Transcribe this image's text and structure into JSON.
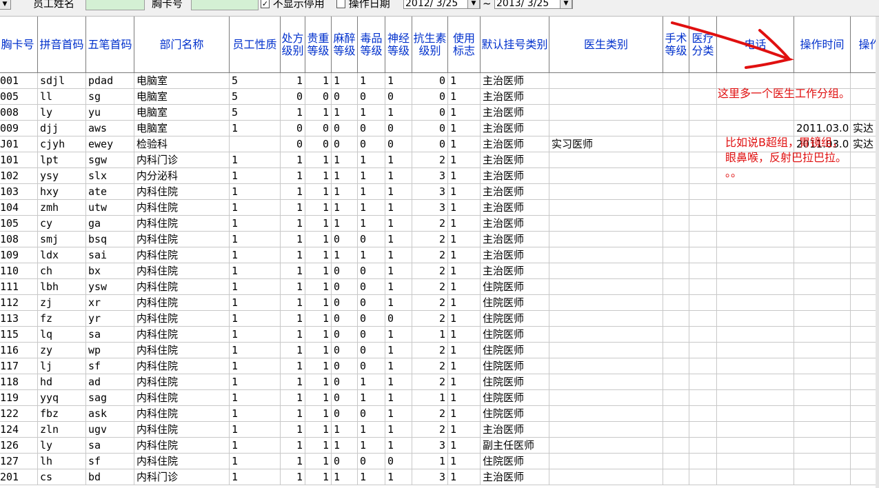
{
  "toolbar": {
    "f0_label": "",
    "name_label": "员工姓名",
    "name_value": "",
    "card_label": "胸卡号",
    "card_value": "",
    "hide_disabled_label": "不显示停用",
    "hide_disabled_checked": "✓",
    "op_date_label": "操作日期",
    "date_from": "2012/ 3/25",
    "date_sep": "~",
    "date_to": "2013/ 3/25"
  },
  "columns": [
    "胸卡号",
    "拼音首码",
    "五笔首码",
    "部门名称",
    "员工性质",
    "处方级别",
    "贵重等级",
    "麻醉等级",
    "毒品等级",
    "神经等级",
    "抗生素级别",
    "使用标志",
    "默认挂号类别",
    "医生类别",
    "手术等级",
    "医疗分类",
    "电话",
    "操作时间",
    "操作"
  ],
  "rows": [
    [
      "001",
      "sdjl",
      "pdad",
      "电脑室",
      "5",
      "1",
      "1",
      "1",
      "1",
      "1",
      "0",
      "1",
      "主治医师",
      "",
      "",
      "",
      "",
      "",
      ""
    ],
    [
      "005",
      "ll",
      "sg",
      "电脑室",
      "5",
      "0",
      "0",
      "0",
      "0",
      "0",
      "0",
      "1",
      "主治医师",
      "",
      "",
      "",
      "",
      "",
      ""
    ],
    [
      "008",
      "ly",
      "yu",
      "电脑室",
      "5",
      "1",
      "1",
      "1",
      "1",
      "1",
      "0",
      "1",
      "主治医师",
      "",
      "",
      "",
      "",
      "",
      ""
    ],
    [
      "009",
      "djj",
      "aws",
      "电脑室",
      "1",
      "0",
      "0",
      "0",
      "0",
      "0",
      "0",
      "1",
      "主治医师",
      "",
      "",
      "",
      "",
      "2011.03.0",
      "实达"
    ],
    [
      "J01",
      "cjyh",
      "ewey",
      "检验科",
      "",
      "0",
      "0",
      "0",
      "0",
      "0",
      "0",
      "1",
      "主治医师",
      "实习医师",
      "",
      "",
      "",
      "2011.03.0",
      "实达"
    ],
    [
      "101",
      "lpt",
      "sgw",
      "内科门诊",
      "1",
      "1",
      "1",
      "1",
      "1",
      "1",
      "2",
      "1",
      "主治医师",
      "",
      "",
      "",
      "",
      "",
      ""
    ],
    [
      "102",
      "ysy",
      "slx",
      "内分泌科",
      "1",
      "1",
      "1",
      "1",
      "1",
      "1",
      "3",
      "1",
      "主治医师",
      "",
      "",
      "",
      "",
      "",
      ""
    ],
    [
      "103",
      "hxy",
      "ate",
      "内科住院",
      "1",
      "1",
      "1",
      "1",
      "1",
      "1",
      "3",
      "1",
      "主治医师",
      "",
      "",
      "",
      "",
      "",
      ""
    ],
    [
      "104",
      "zmh",
      "utw",
      "内科住院",
      "1",
      "1",
      "1",
      "1",
      "1",
      "1",
      "3",
      "1",
      "主治医师",
      "",
      "",
      "",
      "",
      "",
      ""
    ],
    [
      "105",
      "cy",
      "ga",
      "内科住院",
      "1",
      "1",
      "1",
      "1",
      "1",
      "1",
      "2",
      "1",
      "主治医师",
      "",
      "",
      "",
      "",
      "",
      ""
    ],
    [
      "108",
      "smj",
      "bsq",
      "内科住院",
      "1",
      "1",
      "1",
      "0",
      "0",
      "1",
      "2",
      "1",
      "主治医师",
      "",
      "",
      "",
      "",
      "",
      ""
    ],
    [
      "109",
      "ldx",
      "sai",
      "内科住院",
      "1",
      "1",
      "1",
      "1",
      "1",
      "1",
      "2",
      "1",
      "主治医师",
      "",
      "",
      "",
      "",
      "",
      ""
    ],
    [
      "110",
      "ch",
      "bx",
      "内科住院",
      "1",
      "1",
      "1",
      "0",
      "0",
      "1",
      "2",
      "1",
      "主治医师",
      "",
      "",
      "",
      "",
      "",
      ""
    ],
    [
      "111",
      "lbh",
      "ysw",
      "内科住院",
      "1",
      "1",
      "1",
      "0",
      "0",
      "1",
      "2",
      "1",
      "住院医师",
      "",
      "",
      "",
      "",
      "",
      ""
    ],
    [
      "112",
      "zj",
      "xr",
      "内科住院",
      "1",
      "1",
      "1",
      "0",
      "0",
      "1",
      "2",
      "1",
      "住院医师",
      "",
      "",
      "",
      "",
      "",
      ""
    ],
    [
      "113",
      "fz",
      "yr",
      "内科住院",
      "1",
      "1",
      "1",
      "0",
      "0",
      "0",
      "2",
      "1",
      "住院医师",
      "",
      "",
      "",
      "",
      "",
      ""
    ],
    [
      "115",
      "lq",
      "sa",
      "内科住院",
      "1",
      "1",
      "1",
      "0",
      "0",
      "1",
      "1",
      "1",
      "住院医师",
      "",
      "",
      "",
      "",
      "",
      ""
    ],
    [
      "116",
      "zy",
      "wp",
      "内科住院",
      "1",
      "1",
      "1",
      "0",
      "0",
      "1",
      "2",
      "1",
      "住院医师",
      "",
      "",
      "",
      "",
      "",
      ""
    ],
    [
      "117",
      "lj",
      "sf",
      "内科住院",
      "1",
      "1",
      "1",
      "0",
      "0",
      "1",
      "2",
      "1",
      "住院医师",
      "",
      "",
      "",
      "",
      "",
      ""
    ],
    [
      "118",
      "hd",
      "ad",
      "内科住院",
      "1",
      "1",
      "1",
      "0",
      "1",
      "1",
      "2",
      "1",
      "住院医师",
      "",
      "",
      "",
      "",
      "",
      ""
    ],
    [
      "119",
      "yyq",
      "sag",
      "内科住院",
      "1",
      "1",
      "1",
      "0",
      "1",
      "1",
      "1",
      "1",
      "住院医师",
      "",
      "",
      "",
      "",
      "",
      ""
    ],
    [
      "122",
      "fbz",
      "ask",
      "内科住院",
      "1",
      "1",
      "1",
      "0",
      "0",
      "1",
      "2",
      "1",
      "住院医师",
      "",
      "",
      "",
      "",
      "",
      ""
    ],
    [
      "124",
      "zln",
      "ugv",
      "内科住院",
      "1",
      "1",
      "1",
      "1",
      "1",
      "1",
      "2",
      "1",
      "主治医师",
      "",
      "",
      "",
      "",
      "",
      ""
    ],
    [
      "126",
      "ly",
      "sa",
      "内科住院",
      "1",
      "1",
      "1",
      "1",
      "1",
      "1",
      "3",
      "1",
      "副主任医师",
      "",
      "",
      "",
      "",
      "",
      ""
    ],
    [
      "127",
      "lh",
      "sf",
      "内科住院",
      "1",
      "1",
      "1",
      "0",
      "0",
      "0",
      "1",
      "1",
      "住院医师",
      "",
      "",
      "",
      "",
      "",
      ""
    ],
    [
      "201",
      "cs",
      "bd",
      "内科门诊",
      "1",
      "1",
      "1",
      "1",
      "1",
      "1",
      "3",
      "1",
      "主治医师",
      "",
      "",
      "",
      "",
      "",
      ""
    ]
  ],
  "annotation": {
    "note1": "这里多一个医生工作分组。",
    "note2_a": "比如说B超组，胃镜组，",
    "note2_b": "眼鼻喉，反射巴拉巴拉。",
    "note2_c": "。。",
    "color": "#e01010"
  }
}
